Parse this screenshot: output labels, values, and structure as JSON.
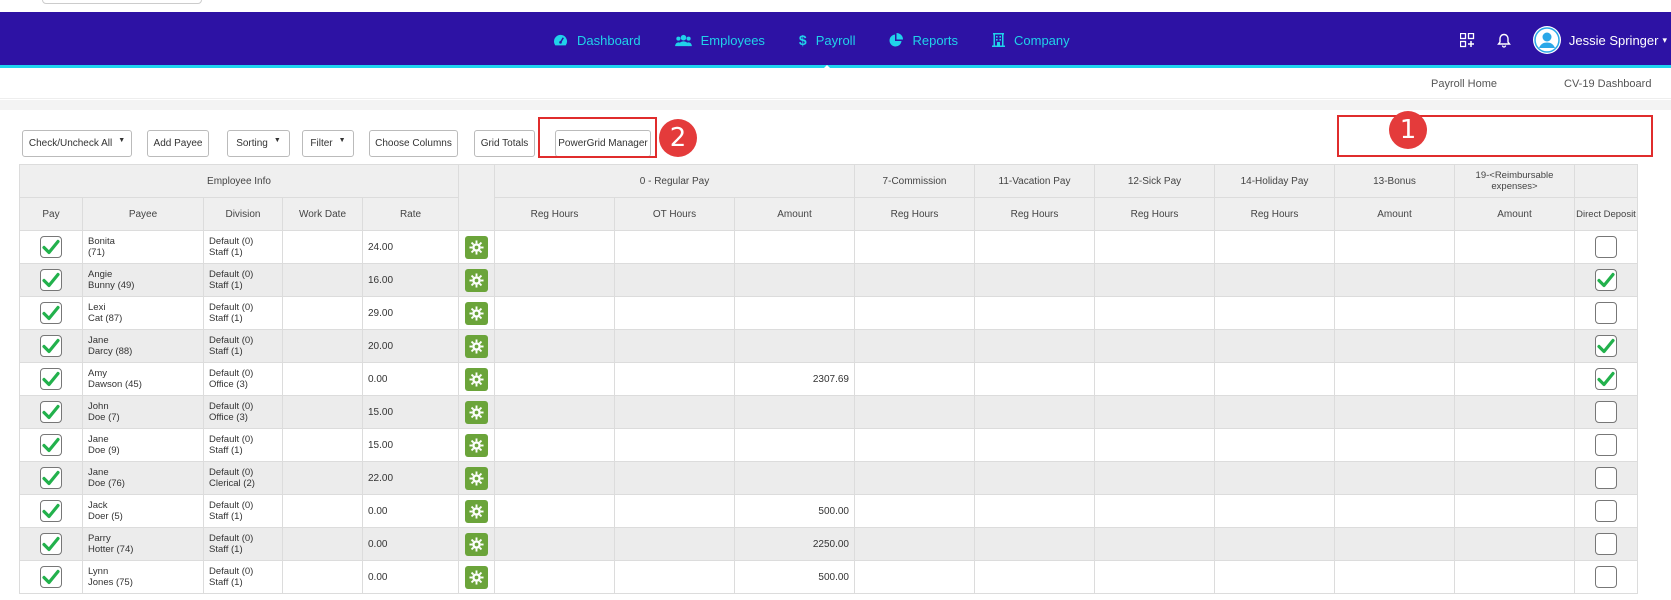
{
  "nav": {
    "items": [
      {
        "label": "Dashboard",
        "icon": "gauge-icon",
        "active": false
      },
      {
        "label": "Employees",
        "icon": "users-icon",
        "active": false
      },
      {
        "label": "Payroll",
        "icon": "dollar-icon",
        "active": true
      },
      {
        "label": "Reports",
        "icon": "pie-chart-icon",
        "active": false
      },
      {
        "label": "Company",
        "icon": "building-icon",
        "active": false
      }
    ],
    "user_name": "Jessie Springer"
  },
  "subnav": {
    "payroll_home": "Payroll Home",
    "cv19_dashboard": "CV-19 Dashboard"
  },
  "toolbar": {
    "check_uncheck_all": "Check/Uncheck All",
    "add_payee": "Add Payee",
    "sorting": "Sorting",
    "filter": "Filter",
    "choose_columns": "Choose Columns",
    "grid_totals": "Grid Totals",
    "powergrid_manager": "PowerGrid Manager"
  },
  "callouts": {
    "one": "1",
    "two": "2"
  },
  "colors": {
    "navbar": "#2d12a4",
    "nav_accent": "#20d2ea",
    "highlight": "#e02c2c",
    "check": "#22b14c",
    "gear_button": "#6ba43a"
  },
  "grid": {
    "groups": {
      "employee_info": "Employee Info",
      "regular_pay": "0 - Regular Pay",
      "commission": "7-Commission",
      "vacation": "11-Vacation Pay",
      "sick": "12-Sick Pay",
      "holiday": "14-Holiday Pay",
      "bonus": "13-Bonus",
      "reimbursable": "19-<Reimbursable expenses>"
    },
    "columns": {
      "pay": "Pay",
      "payee": "Payee",
      "division": "Division",
      "work_date": "Work Date",
      "rate": "Rate",
      "reg_hours": "Reg Hours",
      "ot_hours": "OT Hours",
      "amount": "Amount",
      "commission_reg_hours": "Reg Hours",
      "vacation_reg_hours": "Reg Hours",
      "sick_reg_hours": "Reg Hours",
      "holiday_reg_hours": "Reg Hours",
      "bonus_amount": "Amount",
      "reimb_amount": "Amount",
      "direct_deposit": "Direct Deposit"
    },
    "rows": [
      {
        "pay": true,
        "first": "Bonita",
        "last": "(71)",
        "div1": "Default (0)",
        "div2": "Staff (1)",
        "rate": "24.00",
        "amount": "",
        "dd": false
      },
      {
        "pay": true,
        "first": "Angie",
        "last": "Bunny (49)",
        "div1": "Default (0)",
        "div2": "Staff (1)",
        "rate": "16.00",
        "amount": "",
        "dd": true
      },
      {
        "pay": true,
        "first": "Lexi",
        "last": "Cat (87)",
        "div1": "Default (0)",
        "div2": "Staff (1)",
        "rate": "29.00",
        "amount": "",
        "dd": false
      },
      {
        "pay": true,
        "first": "Jane",
        "last": "Darcy (88)",
        "div1": "Default (0)",
        "div2": "Staff (1)",
        "rate": "20.00",
        "amount": "",
        "dd": true
      },
      {
        "pay": true,
        "first": "Amy",
        "last": "Dawson (45)",
        "div1": "Default (0)",
        "div2": "Office (3)",
        "rate": "0.00",
        "amount": "2307.69",
        "dd": true
      },
      {
        "pay": true,
        "first": "John",
        "last": "Doe (7)",
        "div1": "Default (0)",
        "div2": "Office (3)",
        "rate": "15.00",
        "amount": "",
        "dd": false
      },
      {
        "pay": true,
        "first": "Jane",
        "last": "Doe (9)",
        "div1": "Default (0)",
        "div2": "Staff (1)",
        "rate": "15.00",
        "amount": "",
        "dd": false
      },
      {
        "pay": true,
        "first": "Jane",
        "last": "Doe (76)",
        "div1": "Default (0)",
        "div2": "Clerical (2)",
        "rate": "22.00",
        "amount": "",
        "dd": false
      },
      {
        "pay": true,
        "first": "Jack",
        "last": "Doer (5)",
        "div1": "Default (0)",
        "div2": "Staff (1)",
        "rate": "0.00",
        "amount": "500.00",
        "dd": false
      },
      {
        "pay": true,
        "first": "Parry",
        "last": "Hotter (74)",
        "div1": "Default (0)",
        "div2": "Staff (1)",
        "rate": "0.00",
        "amount": "2250.00",
        "dd": false
      },
      {
        "pay": true,
        "first": "Lynn",
        "last": "Jones (75)",
        "div1": "Default (0)",
        "div2": "Staff (1)",
        "rate": "0.00",
        "amount": "500.00",
        "dd": false
      }
    ]
  }
}
